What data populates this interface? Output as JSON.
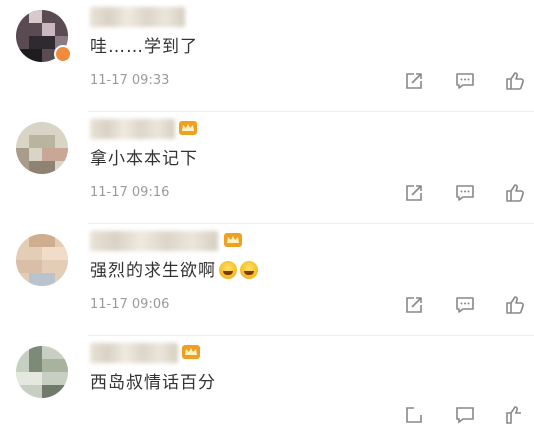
{
  "comments": [
    {
      "text": "哇……学到了",
      "time": "11-17 09:33",
      "has_crown": false,
      "emojis": []
    },
    {
      "text": "拿小本本记下",
      "time": "11-17 09:16",
      "has_crown": true,
      "emojis": []
    },
    {
      "text": "强烈的求生欲啊",
      "time": "11-17 09:06",
      "has_crown": true,
      "emojis": [
        "laugh-cry-emoji",
        "laugh-cry-emoji"
      ]
    },
    {
      "text": "西岛叔情话百分",
      "time": "",
      "has_crown": true,
      "emojis": []
    }
  ],
  "icons": {
    "repost": "repost-icon",
    "comment": "comment-icon",
    "like": "like-icon",
    "crown": "member-crown-icon"
  },
  "colors": {
    "text": "#333333",
    "timestamp": "#9a9a9a",
    "crown": "#f0a020",
    "icons": "#888888"
  }
}
